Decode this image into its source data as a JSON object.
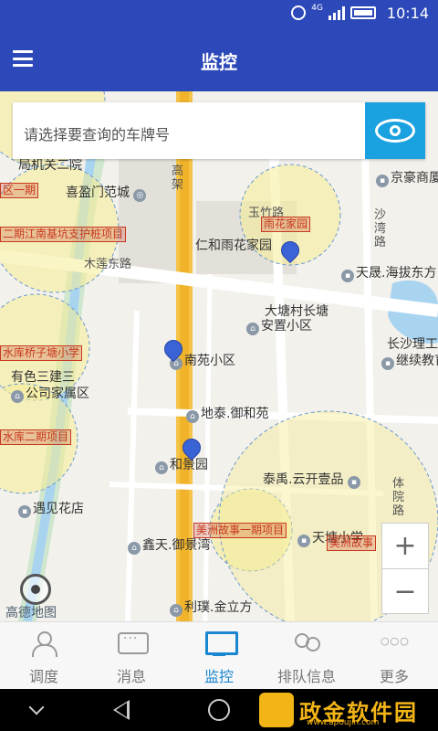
{
  "status_bar": {
    "time": "10:14",
    "network": "4G"
  },
  "app_bar": {
    "title": "监控",
    "menu_icon": "hamburger-icon"
  },
  "search": {
    "placeholder": "请选择要查询的车牌号",
    "action_icon": "eye-icon"
  },
  "map": {
    "provider_logo": "高德地图",
    "zoom_in": "+",
    "zoom_out": "−",
    "roads": [
      {
        "name": "木莲东路"
      },
      {
        "name": "玉竹路"
      },
      {
        "name": "沙湾路"
      },
      {
        "name": "体院路"
      },
      {
        "name": "高架"
      }
    ],
    "pois": [
      {
        "name": "喜盈门范城"
      },
      {
        "name": "仁和雨花家园"
      },
      {
        "name": "京豪商厦"
      },
      {
        "name": "天晟.海拔东方"
      },
      {
        "name": "大塘村长塘"
      },
      {
        "name": "安置小区"
      },
      {
        "name": "长沙理工"
      },
      {
        "name": "继续教育"
      },
      {
        "name": "有色三建三"
      },
      {
        "name": "公司家属区"
      },
      {
        "name": "南苑小区"
      },
      {
        "name": "地泰.御和苑"
      },
      {
        "name": "和景园"
      },
      {
        "name": "泰禹.云开壹品"
      },
      {
        "name": "遇见花店"
      },
      {
        "name": "鑫天.御景湾"
      },
      {
        "name": "天塘小学"
      },
      {
        "name": "利璞.金立方"
      },
      {
        "name": "局机关二院"
      }
    ],
    "fence_labels": [
      {
        "text": "区一期"
      },
      {
        "text": "二期江南基坑支护桩项目"
      },
      {
        "text": "雨花家园"
      },
      {
        "text": "水库桥子塘小学"
      },
      {
        "text": "水库二期项目"
      },
      {
        "text": "美洲故事一期项目"
      },
      {
        "text": "美洲故事"
      }
    ],
    "vehicle_markers": [
      "vehicle-1",
      "vehicle-2",
      "vehicle-3"
    ]
  },
  "tabs": [
    {
      "label": "调度",
      "icon": "person-icon",
      "active": false
    },
    {
      "label": "消息",
      "icon": "message-icon",
      "active": false
    },
    {
      "label": "监控",
      "icon": "monitor-icon",
      "active": true
    },
    {
      "label": "排队信息",
      "icon": "group-icon",
      "active": false
    },
    {
      "label": "更多",
      "icon": "more-icon",
      "active": false
    }
  ],
  "watermark": {
    "text": "政金软件园",
    "sub": "www.apoujin.com"
  },
  "colors": {
    "primary": "#2d49b9",
    "accent": "#1aa1df",
    "tab_active": "#1a86d0",
    "fence_red": "#c8391f"
  }
}
